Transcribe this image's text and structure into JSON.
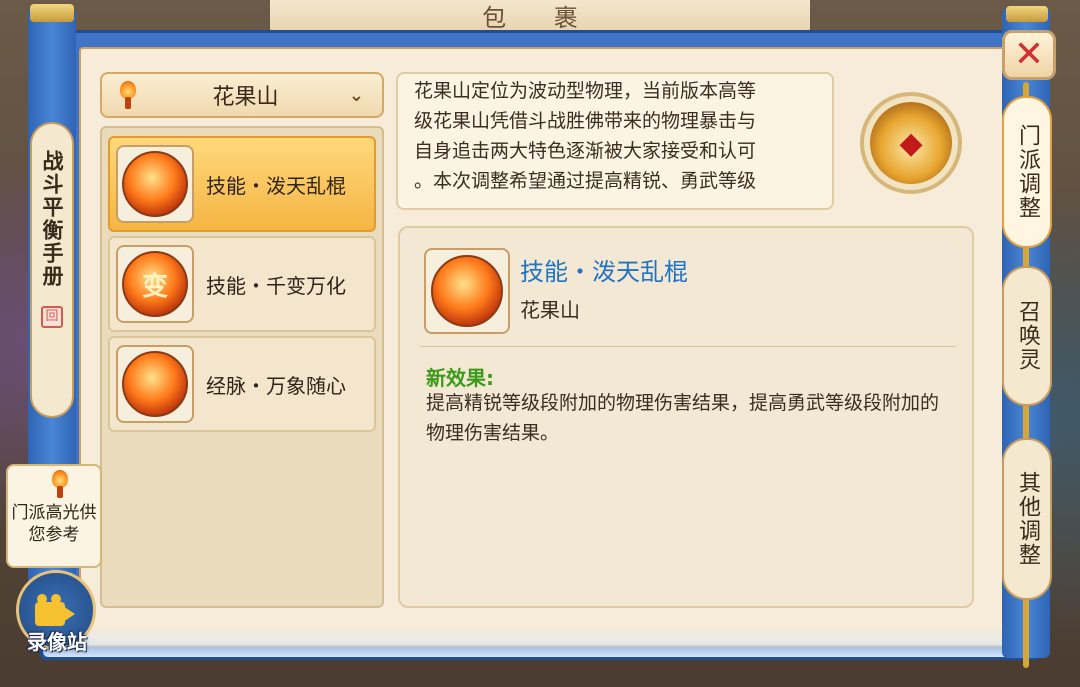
{
  "window": {
    "title": "包 裹"
  },
  "left_tab": {
    "label": "战斗平衡手册",
    "stamp": "回"
  },
  "dropdown": {
    "selected": "花果山",
    "icon": "torch-icon"
  },
  "skills": [
    {
      "name": "技能・泼天乱棍",
      "icon": "fire-scroll-icon",
      "selected": true
    },
    {
      "name": "技能・千变万化",
      "icon": "fire-avatar-icon",
      "glyph": "变",
      "selected": false
    },
    {
      "name": "经脉・万象随心",
      "icon": "fire-beast-icon",
      "selected": false
    }
  ],
  "description": {
    "lines": [
      "花果山定位为波动型物理，当前版本高等",
      "级花果山凭借斗战胜佛带来的物理暴击与",
      "自身追击两大特色逐渐被大家接受和认可",
      "。本次调整希望通过提高精锐、勇武等级"
    ]
  },
  "detail": {
    "title": "技能・泼天乱棍",
    "school": "花果山",
    "effect_label": "新效果:",
    "effect_text": "提高精锐等级段附加的物理伤害结果，提高勇武等级段附加的物理伤害结果。"
  },
  "right_tabs": [
    {
      "label": "门派调整",
      "active": true
    },
    {
      "label": "召唤灵",
      "active": false
    },
    {
      "label": "其他调整",
      "active": false
    }
  ],
  "tip": {
    "text": "门派高光供您参考"
  },
  "record": {
    "label": "录像站"
  },
  "colors": {
    "frame_blue": "#3f74c6",
    "selected_gold": "#f5b544",
    "title_blue": "#1f74c4",
    "effect_green": "#3c9a1a",
    "close_red": "#d23030"
  }
}
